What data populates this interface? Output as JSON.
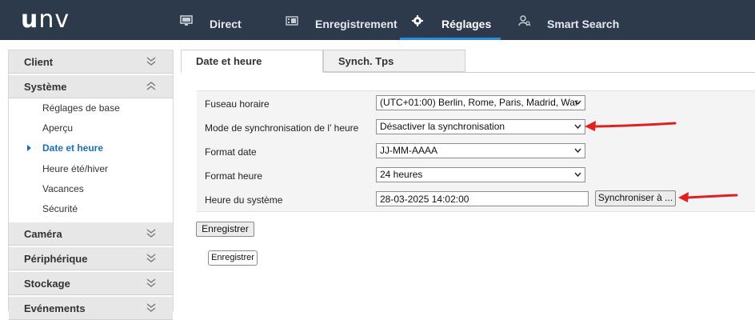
{
  "header": {
    "logo": {
      "u": "u",
      "nv": "nv"
    },
    "nav": [
      {
        "label": "Direct",
        "icon": "monitor-icon"
      },
      {
        "label": "Enregistrement",
        "icon": "film-icon"
      },
      {
        "label": "Réglages",
        "icon": "gear-icon",
        "active": true
      },
      {
        "label": "Smart Search",
        "icon": "person-search-icon"
      }
    ],
    "accent_color": "#2a8bd8",
    "bar_color": "#2d3a4b"
  },
  "sidebar": {
    "sections": [
      {
        "label": "Client",
        "state": "collapsed"
      },
      {
        "label": "Système",
        "state": "expanded"
      },
      {
        "label": "Caméra",
        "state": "collapsed"
      },
      {
        "label": "Périphérique",
        "state": "collapsed"
      },
      {
        "label": "Stockage",
        "state": "collapsed"
      },
      {
        "label": "Evénements",
        "state": "collapsed"
      }
    ],
    "system_items": [
      {
        "label": "Réglages de base"
      },
      {
        "label": "Aperçu"
      },
      {
        "label": "Date et heure",
        "active": true
      },
      {
        "label": "Heure été/hiver"
      },
      {
        "label": "Vacances"
      },
      {
        "label": "Sécurité"
      }
    ]
  },
  "tabs": [
    {
      "label": "Date et heure",
      "active": true
    },
    {
      "label": "Synch. Tps"
    }
  ],
  "form": {
    "timezone": {
      "label": "Fuseau horaire",
      "value": "(UTC+01:00) Berlin, Rome, Paris, Madrid, War"
    },
    "sync_mode": {
      "label": "Mode de synchronisation de l’ heure",
      "value": "Désactiver la synchronisation"
    },
    "date_format": {
      "label": "Format date",
      "value": "JJ-MM-AAAA"
    },
    "time_format": {
      "label": "Format heure",
      "value": "24 heures"
    },
    "system_time": {
      "label": "Heure du système",
      "value": "28-03-2025 14:02:00",
      "sync_button": "Synchroniser à ..."
    }
  },
  "buttons": {
    "save": "Enregistrer",
    "save_secondary": "Enregistrer"
  },
  "annotations": {
    "arrow_color": "#e02020"
  }
}
